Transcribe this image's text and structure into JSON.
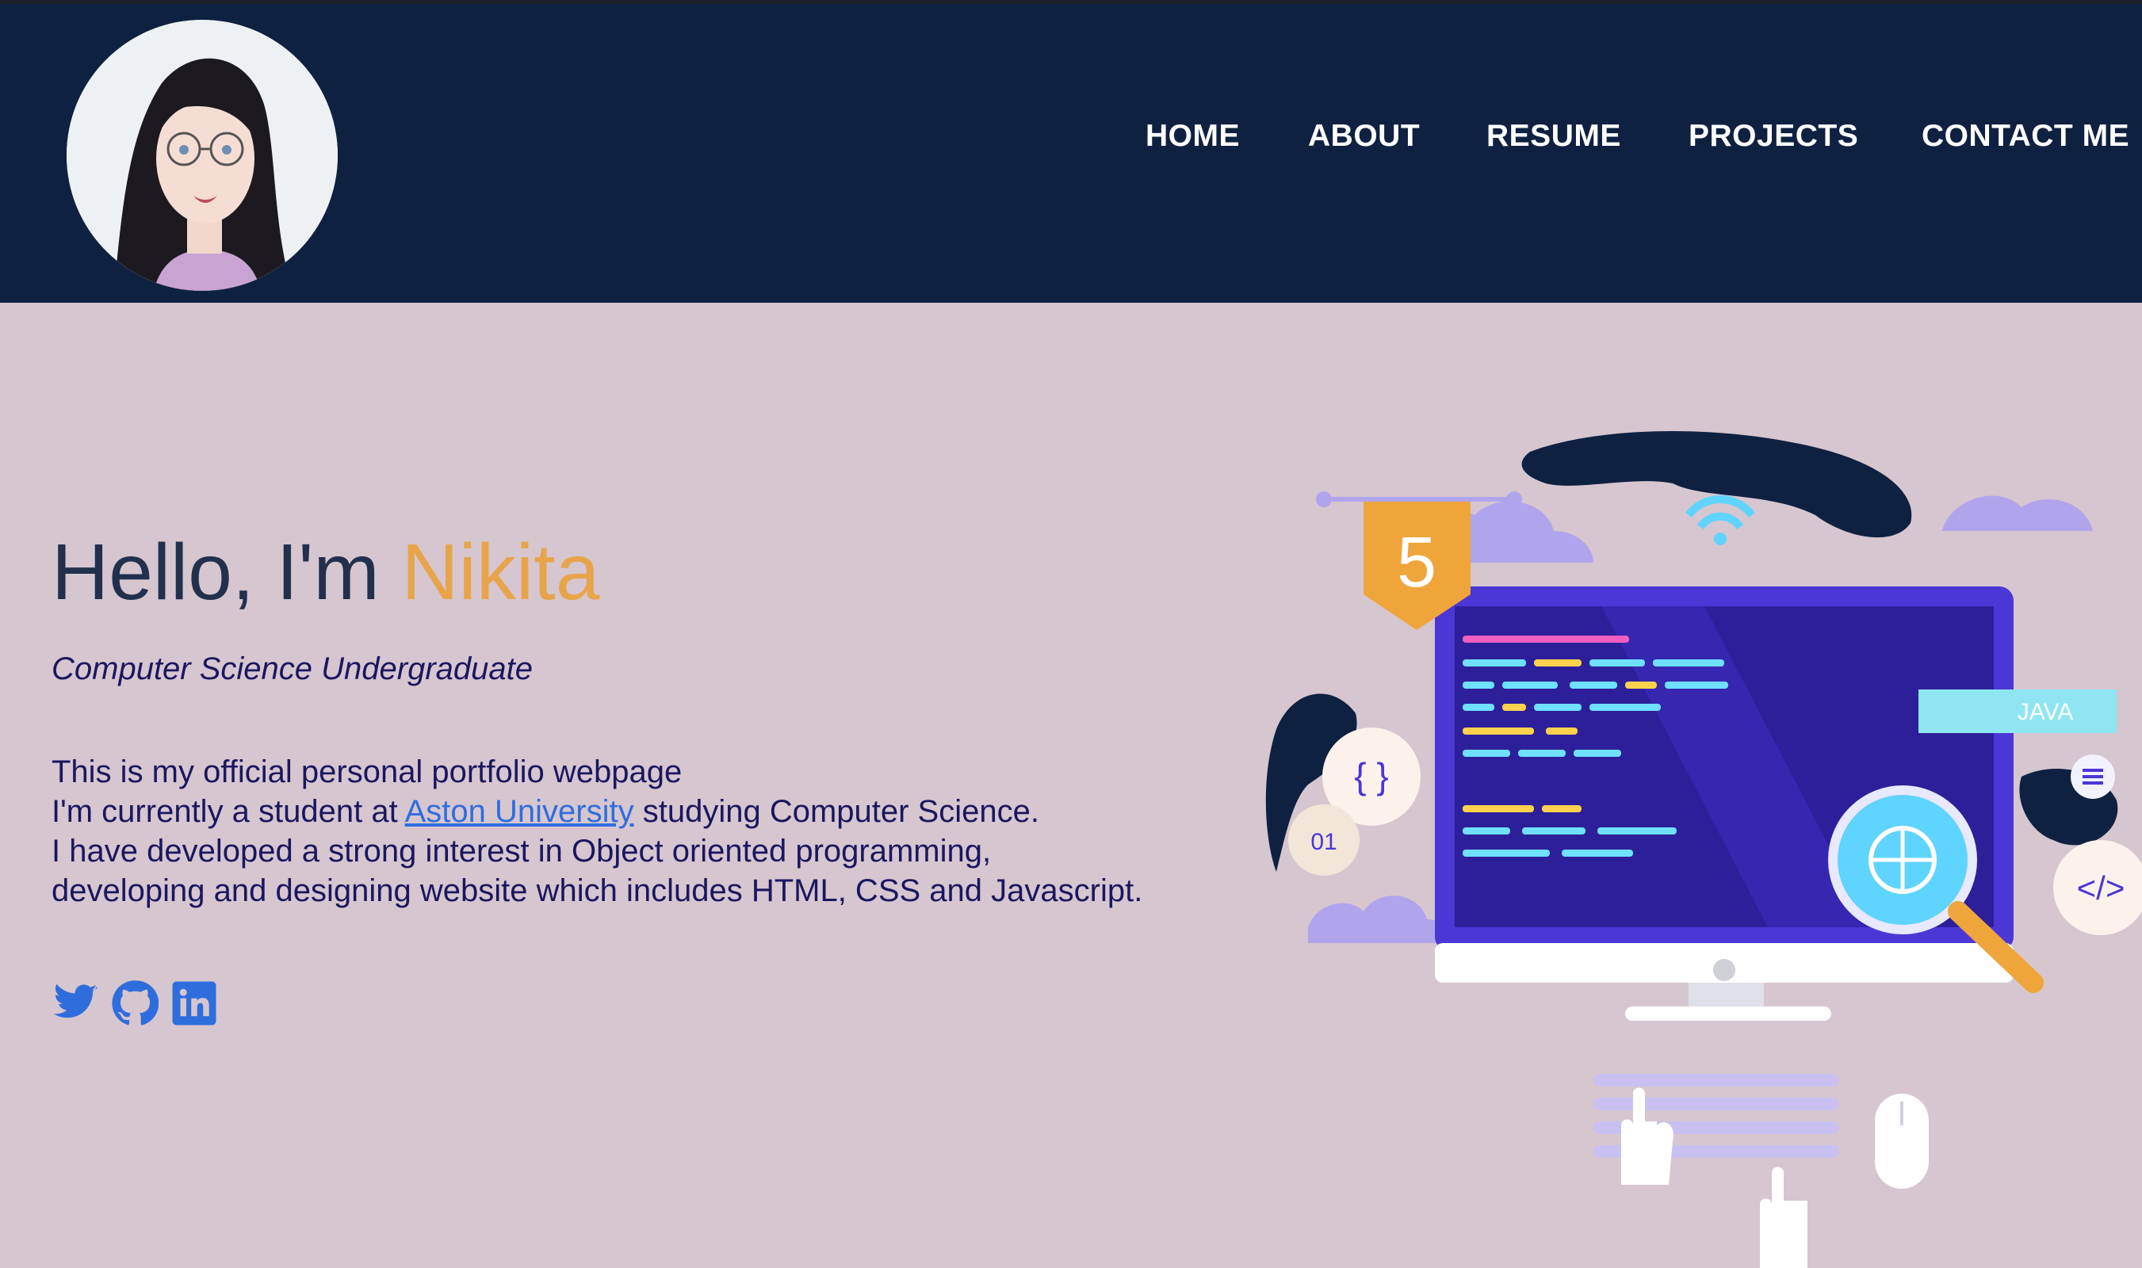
{
  "header": {
    "nav": [
      "HOME",
      "ABOUT",
      "RESUME",
      "PROJECTS",
      "CONTACT ME"
    ]
  },
  "hero": {
    "greeting": "Hello, I'm ",
    "name": "Nikita",
    "subtitle": "Computer Science Undergraduate",
    "bio_line1": "This is my official personal portfolio webpage",
    "bio_line2_pre": "I'm currently a student at ",
    "bio_link": "Aston University",
    "bio_line2_post": " studying Computer Science.",
    "bio_rest": "I have developed a strong interest in Object oriented programming, developing and designing website which includes HTML, CSS and Javascript."
  },
  "socials": [
    "twitter-icon",
    "github-icon",
    "linkedin-icon"
  ],
  "illustration": {
    "badge_number": "5",
    "java_label": "JAVA",
    "braces": "{ }",
    "binary": "01",
    "code_tag": "</>"
  },
  "colors": {
    "header_bg": "#0f2141",
    "page_bg": "#d6c6cf",
    "accent": "#e8a44a",
    "text": "#1a1760",
    "link": "#2e6ee0",
    "icon": "#2f6ddc"
  }
}
